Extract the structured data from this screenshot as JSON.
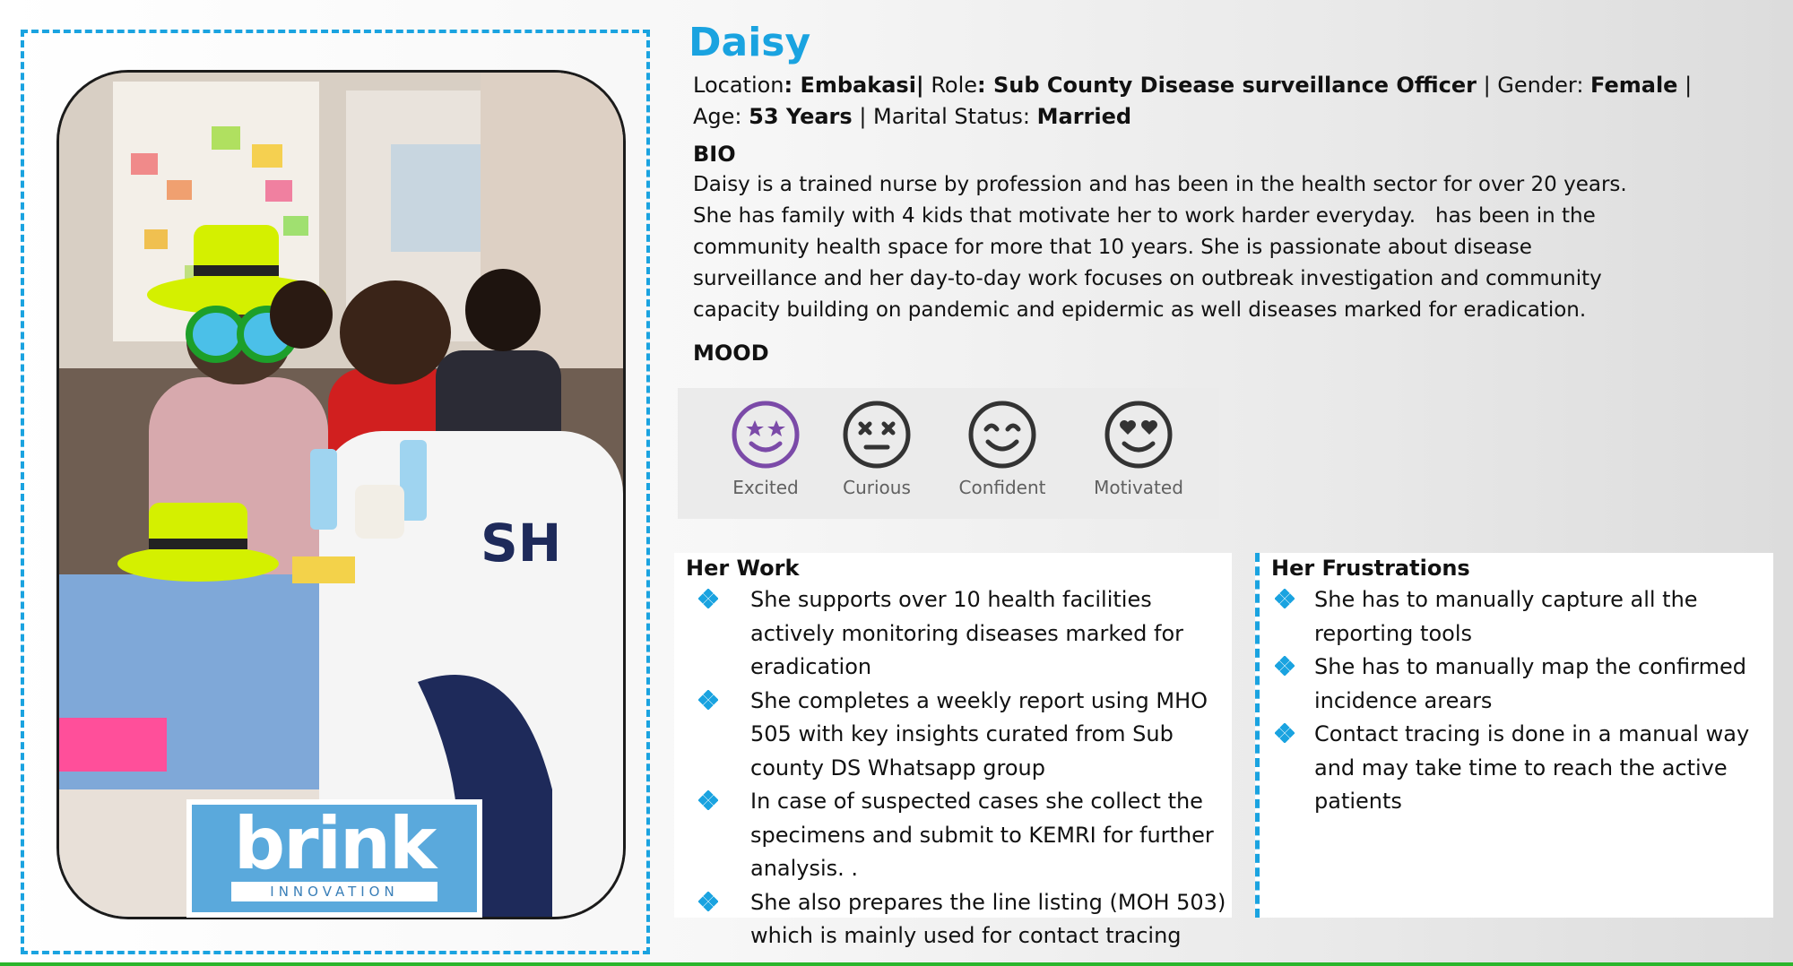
{
  "persona": {
    "name": "Daisy",
    "location_label": "Location",
    "location": "Embakasi|",
    "role_label": "Role",
    "role": "Sub County Disease surveillance Officer",
    "gender_label": "Gender:",
    "gender": "Female",
    "age_label": "Age:",
    "age": "53 Years",
    "marital_label": "Marital Status:",
    "marital": "Married"
  },
  "bio": {
    "title": "BIO",
    "lines": [
      "Daisy is a trained nurse by profession and has been in the health sector for over 20 years.",
      "She has family with 4 kids that motivate her to work harder everyday.   has been in the",
      "community health space for more that 10 years. She is passionate about disease",
      "surveillance and her day-to-day work focuses on outbreak investigation and community",
      "capacity building on pandemic and epidermic as well diseases marked for eradication."
    ]
  },
  "mood": {
    "title": "MOOD",
    "items": [
      {
        "label": "Excited",
        "icon": "star-eyes-face-icon",
        "color": "#7b4aa8"
      },
      {
        "label": "Curious",
        "icon": "x-eyes-face-icon",
        "color": "#333333"
      },
      {
        "label": "Confident",
        "icon": "smiling-face-icon",
        "color": "#333333"
      },
      {
        "label": "Motivated",
        "icon": "heart-eyes-face-icon",
        "color": "#333333"
      }
    ]
  },
  "work": {
    "title": "Her Work",
    "items": [
      "She supports over 10 health facilities actively monitoring diseases marked for eradication",
      "She completes a weekly report using MHO 505 with key insights curated from Sub county DS Whatsapp group",
      "In case of suspected cases she collect the specimens and submit to KEMRI for further analysis. .",
      "She also prepares the line listing (MOH 503) which is mainly used for contact tracing"
    ]
  },
  "frustrations": {
    "title": "Her Frustrations",
    "items": [
      "She has to manually capture all the reporting tools",
      "She has to manually map the confirmed incidence arears",
      "Contact tracing is done in a manual way and may take time to reach the active patients"
    ]
  },
  "logo": {
    "word": "brink",
    "sub": "INNOVATION"
  },
  "photo": {
    "shirt_text": "SH"
  },
  "colors": {
    "accent": "#1aa3e0",
    "bullet": "#1aa3e0",
    "excited": "#7b4aa8",
    "hat": "#d4f000"
  }
}
